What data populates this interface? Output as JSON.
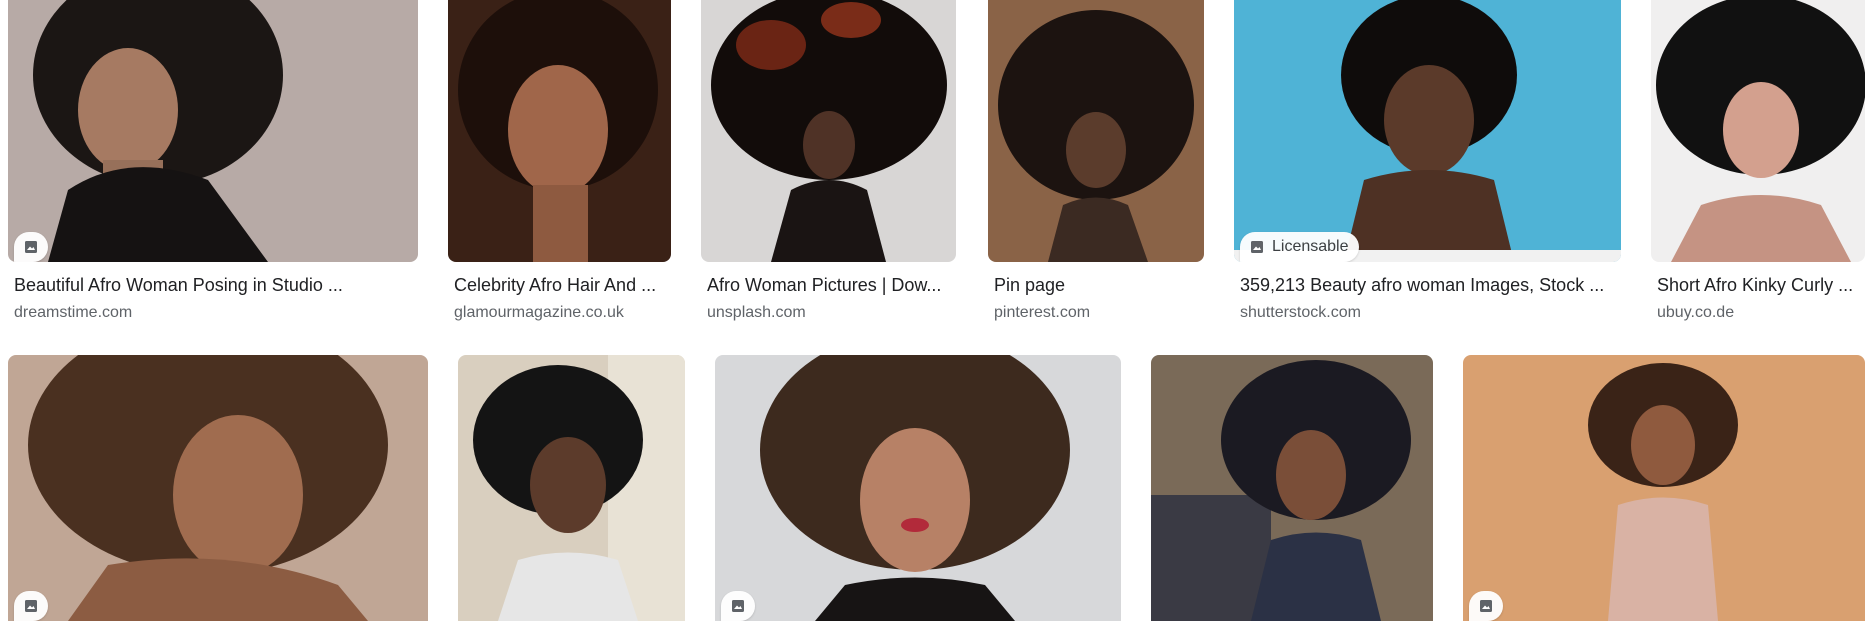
{
  "results": [
    {
      "title": "Beautiful Afro Woman Posing in Studio ...",
      "source": "dreamstime.com",
      "badge": ""
    },
    {
      "title": "Celebrity Afro Hair And ...",
      "source": "glamourmagazine.co.uk",
      "badge": ""
    },
    {
      "title": "Afro Woman Pictures | Dow...",
      "source": "unsplash.com",
      "badge": ""
    },
    {
      "title": "Pin page",
      "source": "pinterest.com",
      "badge": ""
    },
    {
      "title": "359,213 Beauty afro woman Images, Stock ...",
      "source": "shutterstock.com",
      "badge": "Licensable"
    },
    {
      "title": "Short Afro Kinky Curly ...",
      "source": "ubuy.co.de",
      "badge": ""
    },
    {
      "title": "",
      "source": "",
      "badge": ""
    },
    {
      "title": "",
      "source": "",
      "badge": ""
    },
    {
      "title": "",
      "source": "",
      "badge": ""
    },
    {
      "title": "",
      "source": "",
      "badge": ""
    },
    {
      "title": "",
      "source": "",
      "badge": ""
    }
  ],
  "colors": {
    "title": "#202124",
    "source": "#5f6368",
    "badge_bg": "#ffffff"
  },
  "icons": {
    "badge_icon": "image-icon"
  }
}
